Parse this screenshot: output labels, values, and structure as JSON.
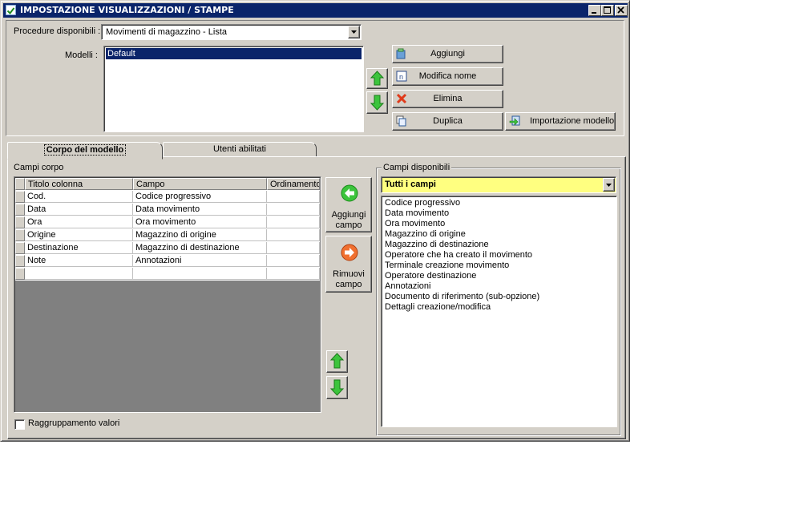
{
  "window": {
    "title": "IMPOSTAZIONE VISUALIZZAZIONI / STAMPE",
    "min": "_",
    "max": "□",
    "close": "×"
  },
  "procedure": {
    "label": "Procedure disponibili :",
    "value": "Movimenti di magazzino - Lista"
  },
  "models": {
    "label": "Modelli :",
    "items": [
      "Default"
    ]
  },
  "model_buttons": {
    "add": "Aggiungi",
    "rename": "Modifica nome",
    "delete": "Elimina",
    "duplicate": "Duplica",
    "import": "Importazione modello"
  },
  "tabs": [
    "Corpo del modello",
    "Utenti abilitati"
  ],
  "body_fields": {
    "label": "Campi corpo",
    "columns": [
      "Titolo colonna",
      "Campo",
      "Ordinamento"
    ],
    "rows": [
      [
        "Cod.",
        "Codice progressivo",
        ""
      ],
      [
        "Data",
        "Data movimento",
        ""
      ],
      [
        "Ora",
        "Ora movimento",
        ""
      ],
      [
        "Origine",
        "Magazzino di origine",
        ""
      ],
      [
        "Destinazione",
        "Magazzino di destinazione",
        ""
      ],
      [
        "Note",
        "Annotazioni",
        ""
      ],
      [
        "",
        "",
        ""
      ]
    ]
  },
  "field_buttons": {
    "add_line1": "Aggiungi",
    "add_line2": "campo",
    "remove_line1": "Rimuovi",
    "remove_line2": "campo"
  },
  "grouping": {
    "label": "Raggruppamento valori",
    "checked": false
  },
  "available": {
    "label": "Campi disponibili",
    "filter": "Tutti i campi",
    "items": [
      "Codice progressivo",
      "Data movimento",
      "Ora movimento",
      "Magazzino di origine",
      "Magazzino di destinazione",
      "Operatore che ha creato il movimento",
      "Terminale creazione movimento",
      "Operatore destinazione",
      "Annotazioni",
      "Documento di riferimento (sub-opzione)",
      "Dettagli creazione/modifica"
    ]
  },
  "colors": {
    "title_bar": "#0a246a",
    "selection": "#0a246a",
    "filter_bg": "#ffff80",
    "arrow_green": "#2eb82e",
    "grid_empty": "#808080"
  }
}
